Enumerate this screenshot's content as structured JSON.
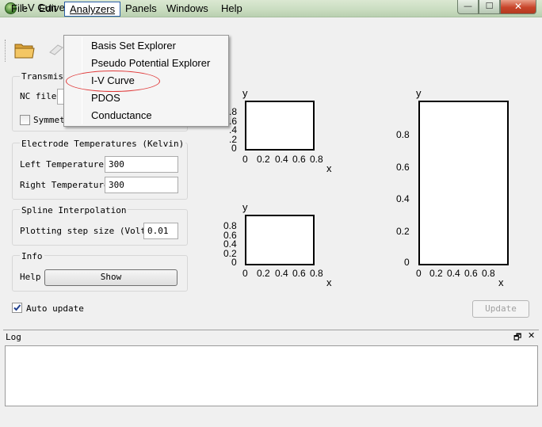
{
  "window": {
    "title": "I-V Curve",
    "min_glyph": "—",
    "max_glyph": "☐",
    "close_glyph": "✕"
  },
  "menubar": {
    "file": "File",
    "edit": "Edit",
    "analyzers": "Analyzers",
    "panels": "Panels",
    "windows": "Windows",
    "help": "Help"
  },
  "analyzers_menu": {
    "items": [
      "Basis Set Explorer",
      "Pseudo Potential Explorer",
      "I-V Curve",
      "PDOS",
      "Conductance"
    ],
    "highlighted": "I-V Curve",
    "highlight_color": "#e03a3a"
  },
  "transmission": {
    "title": "Transmiss",
    "nc_file_label": "NC file",
    "symmetric_label": "Symmet",
    "symmetric_checked": false
  },
  "electrode": {
    "title": "Electrode Temperatures (Kelvin)",
    "left_label": "Left Temperature",
    "left_value": "300",
    "right_label": "Right Temperature",
    "right_value": "300"
  },
  "spline": {
    "title": "Spline Interpolation",
    "step_label": "Plotting step size (Volt)",
    "step_value": "0.01"
  },
  "info": {
    "title": "Info",
    "help_label": "Help",
    "show_button": "Show"
  },
  "auto_update": {
    "label": "Auto update",
    "checked": true
  },
  "update_button": "Update",
  "log": {
    "title": "Log",
    "float_glyph": "🗗",
    "close_glyph": "✕"
  },
  "plots": {
    "top_left": {
      "ylabel": "y",
      "xlabel": "x",
      "y_ticks": [
        ".8",
        ".6",
        ".4",
        ".2",
        "0"
      ],
      "x_ticks": [
        "0",
        "0.2",
        "0.4",
        "0.6",
        "0.8"
      ]
    },
    "bottom_left": {
      "ylabel": "y",
      "xlabel": "x",
      "y_ticks": [
        "0.8",
        "0.6",
        "0.4",
        "0.2",
        "0"
      ],
      "x_ticks": [
        "0",
        "0.2",
        "0.4",
        "0.6",
        "0.8"
      ]
    },
    "right": {
      "ylabel": "y",
      "xlabel": "x",
      "y_ticks": [
        "0.8",
        "0.6",
        "0.4",
        "0.2",
        "0"
      ],
      "x_ticks": [
        "0",
        "0.2",
        "0.4",
        "0.6",
        "0.8"
      ]
    }
  },
  "colors": {
    "menu_border": "#2b5fa8",
    "window_close": "#c8452a"
  }
}
